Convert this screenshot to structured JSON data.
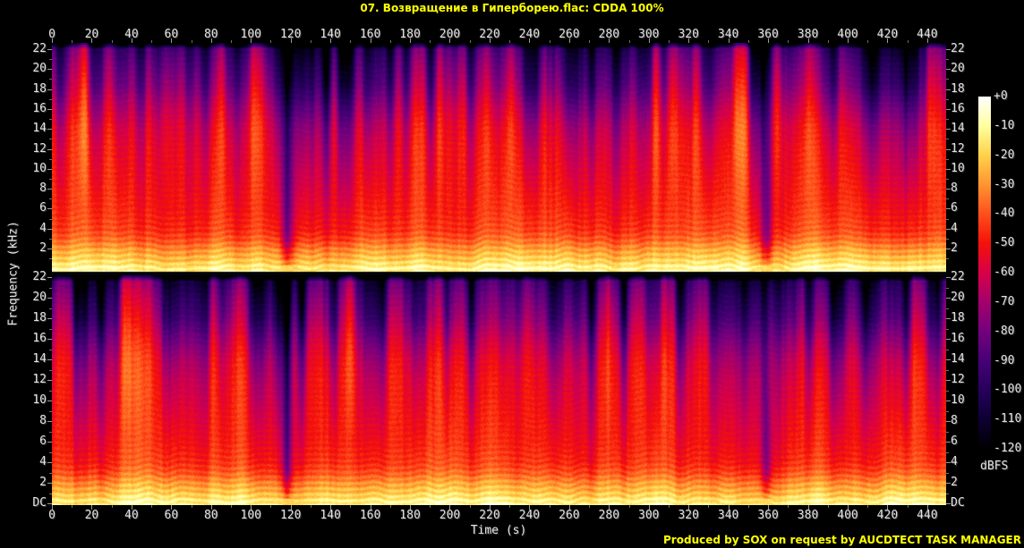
{
  "header": {
    "title": "07. Возвращение в Гиперборею.flac: CDDA 100%"
  },
  "footer": {
    "credit": "Produced by SOX on request by AUCDTECT TASK MANAGER"
  },
  "colors": {
    "background": "#000000",
    "title_text": "#ffff00",
    "footer_text": "#ffff00",
    "axis_text": "#e2e2e2"
  },
  "chart_data": {
    "type": "heatmap",
    "subtype": "audio-spectrogram",
    "xlabel": "Time (s)",
    "ylabel": "Frequency (kHz)",
    "duration_s": 449.5,
    "x_ticks": [
      0,
      20,
      40,
      60,
      80,
      100,
      120,
      140,
      160,
      180,
      200,
      220,
      240,
      260,
      280,
      300,
      320,
      340,
      360,
      380,
      400,
      420,
      440
    ],
    "x_minor_step_s": 10,
    "channels": 2,
    "freq_max_khz": 22.05,
    "freq_tick_labels": [
      "22",
      "20",
      "18",
      "16",
      "14",
      "12",
      "10",
      "8",
      "6",
      "4",
      "2"
    ],
    "dc_label": "DC",
    "colorbar": {
      "unit": "dBFS",
      "max_db": 0,
      "min_db": -120,
      "tick_labels": [
        "+0",
        "-10",
        "-20",
        "-30",
        "-40",
        "-50",
        "-60",
        "-70",
        "-80",
        "-90",
        "-100",
        "-110",
        "-120"
      ],
      "palette": [
        [
          0,
          "#ffffff"
        ],
        [
          -10,
          "#ffff9e"
        ],
        [
          -20,
          "#ffd24a"
        ],
        [
          -30,
          "#ff9430"
        ],
        [
          -40,
          "#ff4f1c"
        ],
        [
          -50,
          "#f51109"
        ],
        [
          -60,
          "#d80048"
        ],
        [
          -70,
          "#a4006b"
        ],
        [
          -80,
          "#74007e"
        ],
        [
          -90,
          "#470076"
        ],
        [
          -100,
          "#26005c"
        ],
        [
          -110,
          "#0d0032"
        ],
        [
          -120,
          "#000000"
        ]
      ]
    },
    "frequency_profile_dbfs": [
      [
        0,
        -10
      ],
      [
        0.5,
        -14
      ],
      [
        1,
        -20
      ],
      [
        2,
        -28
      ],
      [
        3,
        -38
      ],
      [
        4,
        -44
      ],
      [
        6,
        -48
      ],
      [
        8,
        -50
      ],
      [
        10,
        -52
      ],
      [
        12,
        -54
      ],
      [
        14,
        -58
      ],
      [
        16,
        -66
      ],
      [
        18,
        -76
      ],
      [
        20,
        -84
      ],
      [
        21.5,
        -92
      ],
      [
        22.05,
        -103
      ]
    ],
    "quiet_gaps_s": [
      118,
      359
    ],
    "hf_dim_regions_s": [
      [
        272,
        26
      ],
      [
        415,
        20
      ]
    ],
    "loud_band_khz": [
      0,
      2
    ]
  }
}
